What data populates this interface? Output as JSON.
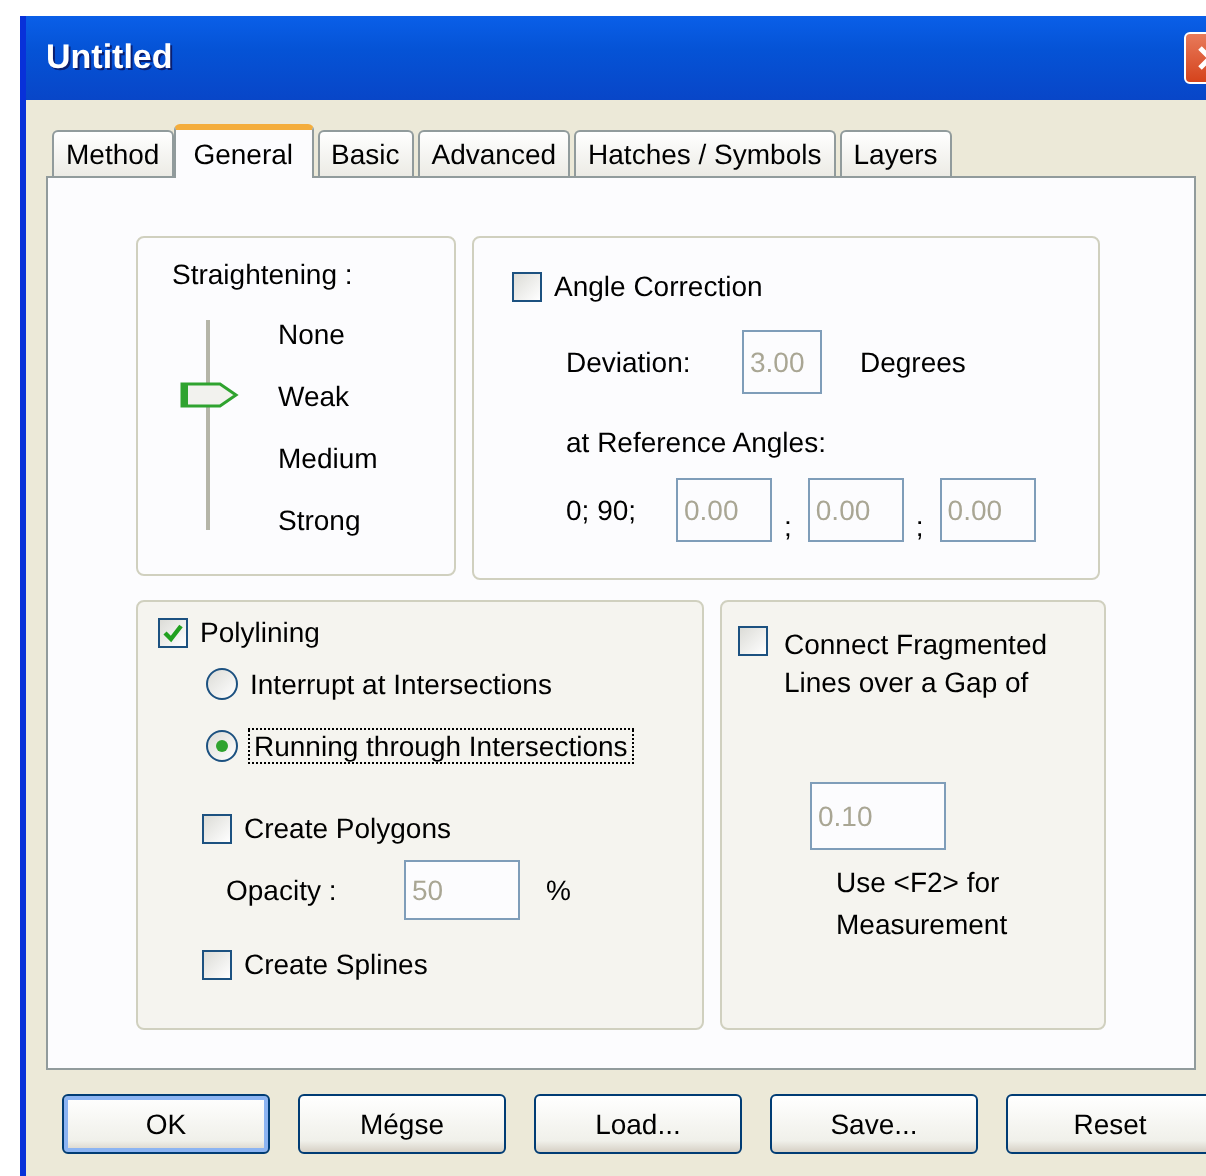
{
  "window": {
    "title": "Untitled"
  },
  "tabs": [
    {
      "label": "Method",
      "selected": false
    },
    {
      "label": "General",
      "selected": true
    },
    {
      "label": "Basic",
      "selected": false
    },
    {
      "label": "Advanced",
      "selected": false
    },
    {
      "label": "Hatches / Symbols",
      "selected": false
    },
    {
      "label": "Layers",
      "selected": false
    }
  ],
  "straightening": {
    "label": "Straightening :",
    "stops": [
      {
        "label": "None",
        "selected": false
      },
      {
        "label": "Weak",
        "selected": true
      },
      {
        "label": "Medium",
        "selected": false
      },
      {
        "label": "Strong",
        "selected": false
      }
    ]
  },
  "angle_correction": {
    "label": "Angle Correction",
    "checked": false,
    "deviation_label": "Deviation:",
    "deviation": "3.00",
    "deviation_unit": "Degrees",
    "reference_label": "at Reference Angles:",
    "fixed_angles": "0; 90;",
    "angles": [
      "0.00",
      "0.00",
      "0.00"
    ],
    "separators": [
      ";",
      ";"
    ]
  },
  "polylining": {
    "label": "Polylining",
    "checked": true,
    "options": [
      {
        "label": "Interrupt at Intersections",
        "selected": false,
        "focused": false
      },
      {
        "label": "Running through Intersections",
        "selected": true,
        "focused": true
      }
    ],
    "create_polygons": {
      "label": "Create Polygons",
      "checked": false
    },
    "opacity_label": "Opacity :",
    "opacity": "50",
    "opacity_unit": "%",
    "create_splines": {
      "label": "Create Splines",
      "checked": false
    }
  },
  "connect": {
    "label": "Connect Fragmented Lines over a Gap of",
    "checked": false,
    "gap": "0.10",
    "hint": "Use <F2> for Measurement"
  },
  "buttons": [
    {
      "label": "OK",
      "default": true
    },
    {
      "label": "Mégse",
      "default": false
    },
    {
      "label": "Load...",
      "default": false
    },
    {
      "label": "Save...",
      "default": false
    },
    {
      "label": "Reset",
      "default": false
    }
  ]
}
